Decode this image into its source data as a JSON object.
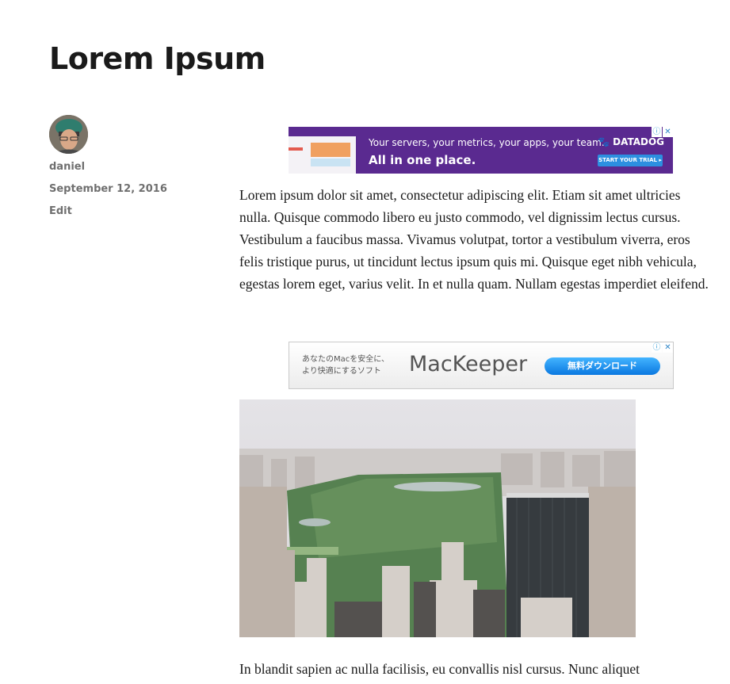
{
  "post": {
    "title": "Lorem Ipsum",
    "author": "daniel",
    "date": "September 12, 2016",
    "edit_label": "Edit",
    "paragraphs": [
      "Lorem ipsum dolor sit amet, consectetur adipiscing elit. Etiam sit amet ultricies nulla. Quisque commodo libero eu justo commodo, vel dignissim lectus cursus. Vestibulum a faucibus massa. Vivamus volutpat, tortor a vestibulum viverra, eros felis tristique purus, ut tincidunt lectus ipsum quis mi. Quisque eget nibh vehicula, egestas lorem eget, varius velit. In et nulla quam. Nullam egestas imperdiet eleifend.",
      "In blandit sapien ac nulla facilisis, eu convallis nisl cursus. Nunc aliquet"
    ]
  },
  "ads": {
    "datadog": {
      "line1": "Your servers, your metrics, your apps, your team.",
      "line2": "All in one place.",
      "brand": "DATADOG",
      "cta": "START YOUR TRIAL ▸",
      "background": "#5a2a90"
    },
    "mackeeper": {
      "jp_line1": "あなたのMacを安全に、",
      "jp_line2": "より快適にするソフト",
      "brand": "MacKeeper",
      "cta": "無料ダウンロード",
      "cta_color": "#1a8ef0"
    },
    "adchoices_icon": "info-icon",
    "close_icon": "close-icon"
  },
  "colors": {
    "text": "#1a1a1a",
    "meta_text": "#6f6f6f"
  }
}
